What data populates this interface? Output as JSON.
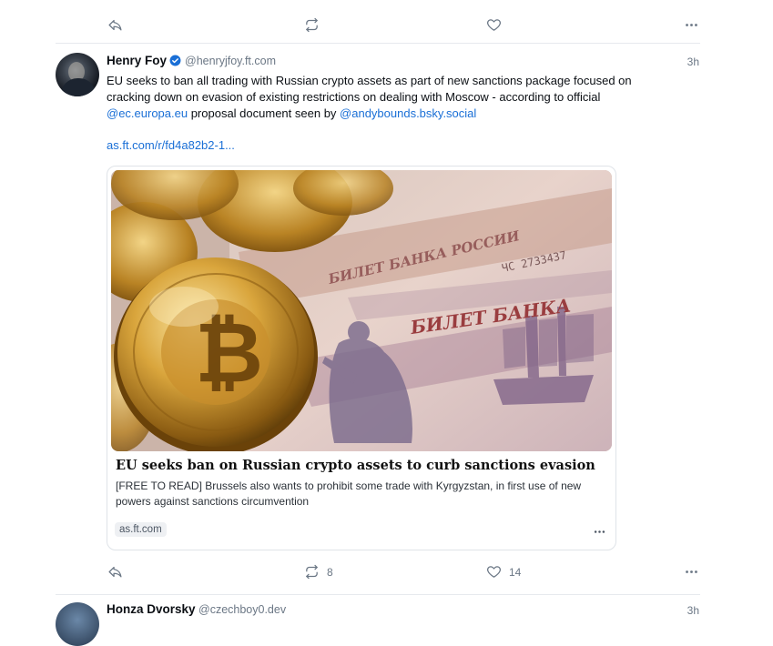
{
  "prev_post": {
    "actions": {
      "reply": "",
      "repost": "",
      "like": ""
    }
  },
  "post": {
    "author_name": "Henry Foy",
    "author_handle": "@henryjfoy.ft.com",
    "time": "3h",
    "text_part1": "EU seeks to ban all trading with Russian crypto assets as part of new sanctions package focused on cracking down on evasion of existing restrictions on dealing with Moscow - according to official ",
    "mention1": "@ec.europa.eu",
    "text_part2": " proposal document seen by ",
    "mention2": "@andybounds.bsky.social",
    "short_link": "as.ft.com/r/fd4a82b2-1...",
    "card": {
      "title": "EU seeks ban on Russian crypto assets to curb sanctions evasion",
      "description": "[FREE TO READ] Brussels also wants to prohibit some trade with Kyrgyzstan, in first use of new powers against sanctions circumvention",
      "domain": "as.ft.com",
      "banknote_text": "БИЛЕТ БАНКА",
      "banknote_text2": "БИЛЕТ БАНКА РОССИИ",
      "serial": "ЧС 2733437"
    },
    "actions": {
      "reply": "",
      "repost": "8",
      "like": "14"
    }
  },
  "next_post": {
    "author_name": "Honza Dvorsky",
    "author_handle": "@czechboy0.dev",
    "time": "3h"
  },
  "icons": {
    "reply": "reply-icon",
    "repost": "repost-icon",
    "like": "heart-icon",
    "more": "more-icon",
    "verified": "verified-badge-icon"
  },
  "colors": {
    "link": "#1a6fd6",
    "verified": "#1a6fd6",
    "muted": "#6b7785"
  }
}
